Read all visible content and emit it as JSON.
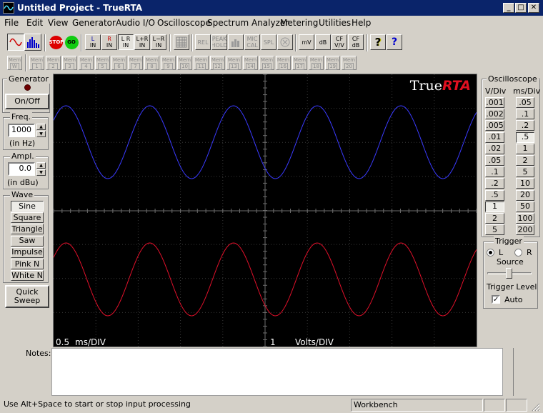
{
  "window": {
    "title": "Untitled Project - TrueRTA",
    "minimize": "_",
    "maximize": "□",
    "close": "✕"
  },
  "menu": [
    "File",
    "Edit",
    "View",
    "Generator",
    "Audio I/O",
    "Oscilloscope",
    "Spectrum Analyzer",
    "Metering",
    "Utilities",
    "Help"
  ],
  "toolbar": {
    "stop": "STOP",
    "go": "GO",
    "channels": [
      [
        "L",
        "IN"
      ],
      [
        "R",
        "IN"
      ],
      [
        "L R",
        "IN"
      ],
      [
        "L+R",
        "IN"
      ],
      [
        "L−R",
        "IN"
      ]
    ],
    "rel": "REL",
    "peak_hold": [
      "PEAK",
      "HOLD"
    ],
    "mic_cal": [
      "MIC",
      "CAL"
    ],
    "spl": "SPL",
    "mv": "mV",
    "db": "dB",
    "cf_vv": [
      "CF",
      "V/V"
    ],
    "cf_db": [
      "CF",
      "dB"
    ],
    "help": "?",
    "context_help": "?"
  },
  "memories": {
    "w": "W",
    "items": [
      "1",
      "2",
      "3",
      "4",
      "5",
      "6",
      "7",
      "8",
      "9",
      "10",
      "11",
      "12",
      "13",
      "14",
      "15",
      "16",
      "17",
      "18",
      "19",
      "20"
    ],
    "label": "Mem"
  },
  "generator": {
    "title": "Generator",
    "onoff": "On/Off",
    "freq": {
      "title": "Freq.",
      "value": "1000",
      "unit": "(in Hz)"
    },
    "ampl": {
      "title": "Ampl.",
      "value": "0.0",
      "unit": "(in dBu)"
    },
    "wave": {
      "title": "Wave",
      "items": [
        "Sine",
        "Square",
        "Triangle",
        "Saw",
        "Impulse",
        "Pink N",
        "White N"
      ],
      "selected": "Sine"
    },
    "quick_sweep": "Quick Sweep"
  },
  "scope": {
    "brand_true": "True",
    "brand_rta": "RTA",
    "time_value": "0.5",
    "time_unit": "ms/DIV",
    "volt_value": "1",
    "volt_unit": "Volts/DIV",
    "colors": {
      "left": "#3a3aff",
      "right": "#e0102a",
      "grid": "#3a3a3a",
      "axis": "#6e6e6e"
    }
  },
  "oscilloscope": {
    "title": "Oscilloscope",
    "vdiv_title": "V/Div",
    "msdiv_title": "ms/Div",
    "vdiv": [
      ".001",
      ".002",
      ".005",
      ".01",
      ".02",
      ".05",
      ".1",
      ".2",
      ".5",
      "1",
      "2",
      "5"
    ],
    "vdiv_selected": "1",
    "msdiv": [
      ".05",
      ".1",
      ".2",
      ".5",
      "1",
      "2",
      "5",
      "10",
      "20",
      "50",
      "100",
      "200"
    ],
    "msdiv_selected": ".5",
    "trigger": {
      "title": "Trigger",
      "left": "L",
      "right": "R",
      "source": "Source",
      "selected": "L",
      "level": "Trigger Level",
      "auto": "Auto",
      "auto_checked": true
    }
  },
  "notes": {
    "label": "Notes:",
    "value": ""
  },
  "status": {
    "hint": "Use Alt+Space to start or stop input processing",
    "mode": "Workbench"
  }
}
